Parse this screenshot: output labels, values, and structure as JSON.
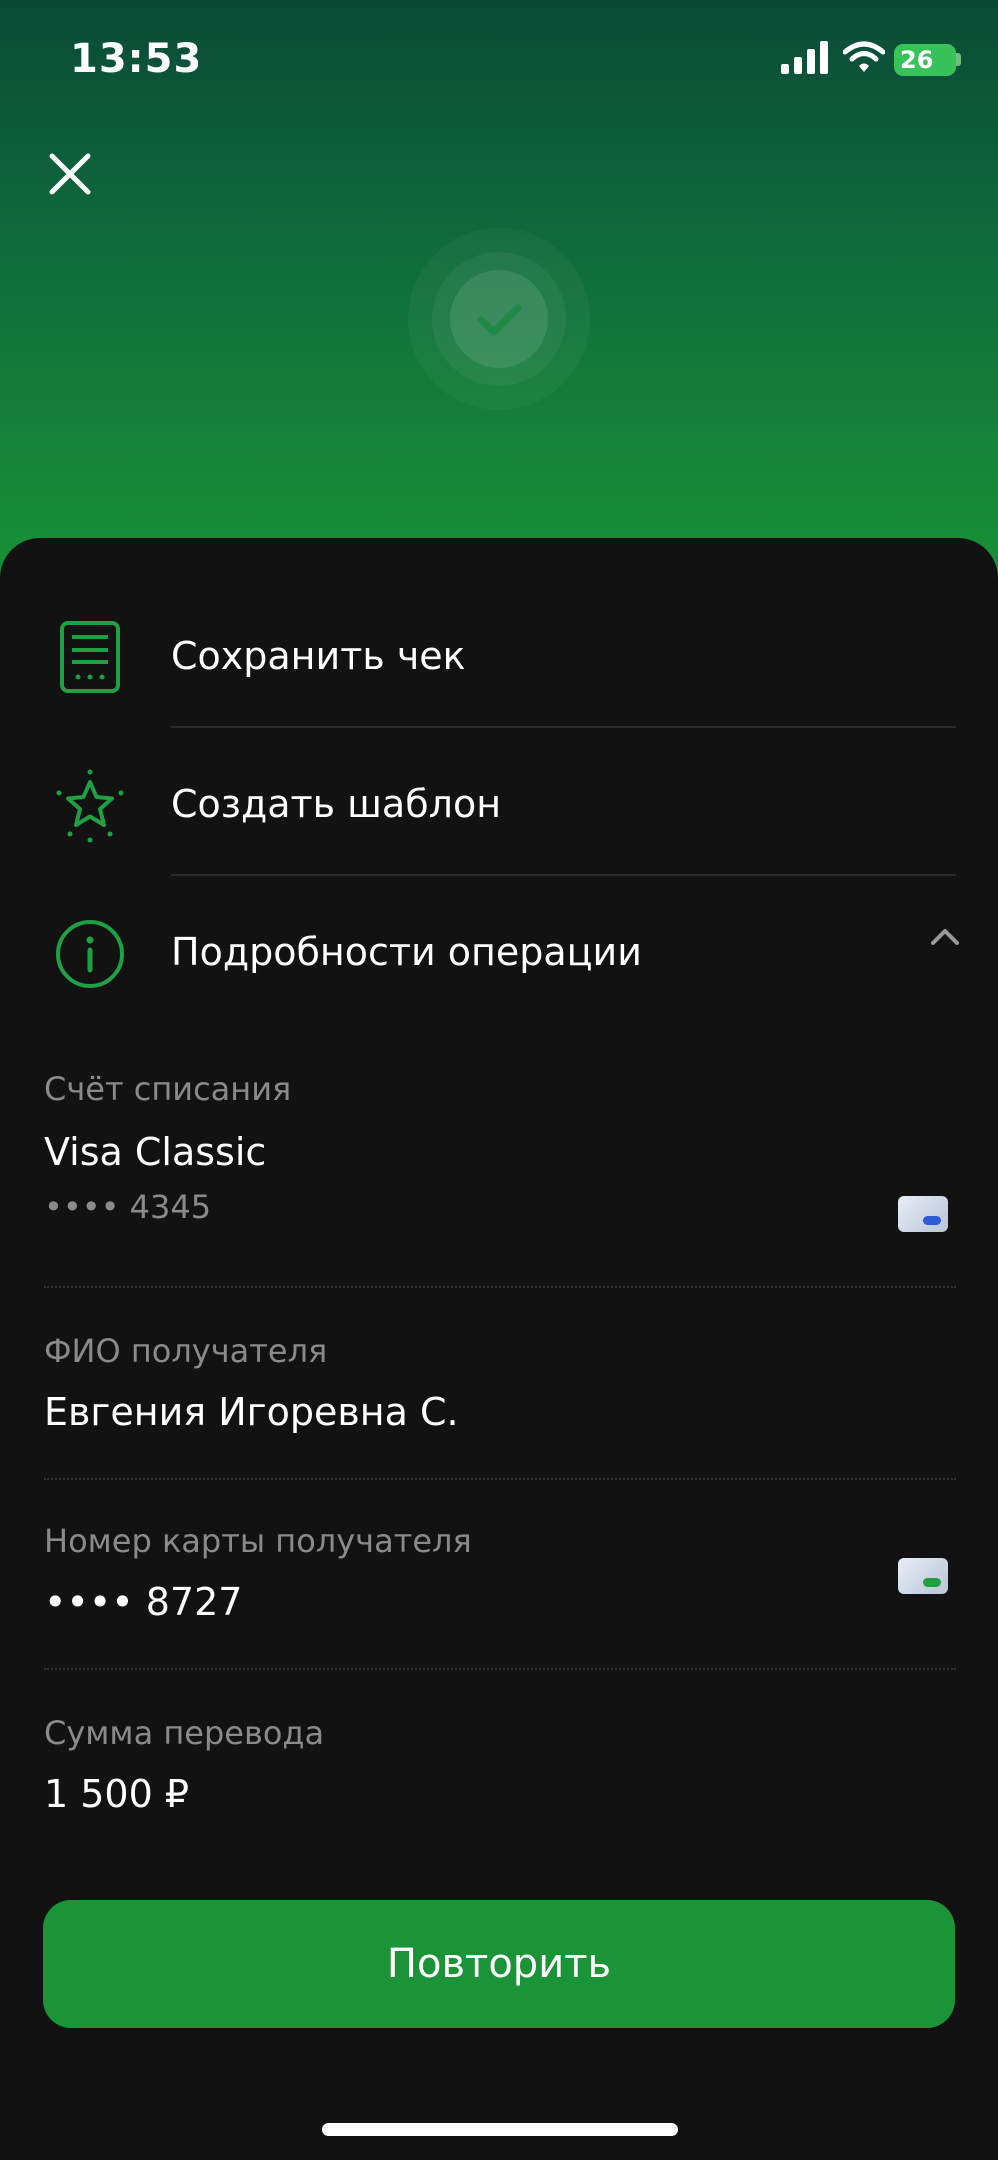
{
  "status_bar": {
    "time": "13:53",
    "battery": "26"
  },
  "actions": [
    {
      "label": "Сохранить чек",
      "icon": "receipt-icon"
    },
    {
      "label": "Создать шаблон",
      "icon": "star-icon"
    },
    {
      "label": "Подробности операции",
      "icon": "info-icon"
    }
  ],
  "details": {
    "account_label": "Счёт списания",
    "account_name": "Visa Classic",
    "account_number": "•••• 4345",
    "recipient_label": "ФИО получателя",
    "recipient_name": "Евгения Игоревна С.",
    "card_label": "Номер карты получателя",
    "card_number": "•••• 8727",
    "amount_label": "Сумма перевода",
    "amount": "1 500 ₽"
  },
  "repeat_button": "Повторить",
  "colors": {
    "accent": "#1a9437",
    "background": "#121212",
    "muted": "#8a8a8a"
  }
}
